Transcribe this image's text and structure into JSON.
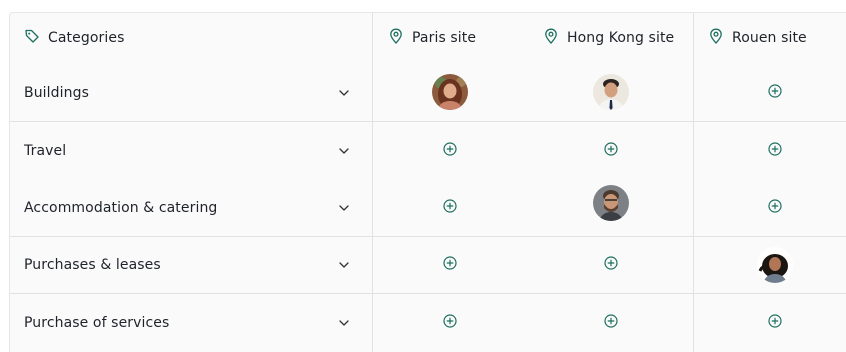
{
  "header": {
    "categories_label": "Categories",
    "categories_icon": "tag-icon",
    "site_icon": "map-pin-icon",
    "sites": [
      "Paris site",
      "Hong Kong site",
      "Rouen site"
    ]
  },
  "rows": [
    {
      "label": "Buildings",
      "cells": [
        "avatar-1",
        "avatar-2",
        "add"
      ]
    },
    {
      "label": "Travel",
      "cells": [
        "add",
        "add",
        "add"
      ]
    },
    {
      "label": "Accommodation & catering",
      "cells": [
        "add",
        "avatar-3",
        "add"
      ]
    },
    {
      "label": "Purchases & leases",
      "cells": [
        "add",
        "add",
        "avatar-4"
      ]
    },
    {
      "label": "Purchase of services",
      "cells": [
        "add",
        "add",
        "add"
      ]
    }
  ],
  "icons": {
    "row_toggle": "chevron-down-icon",
    "add_cell": "plus-circle-icon"
  },
  "colors": {
    "accent": "#1d6f5e",
    "border": "#e2e2e2",
    "panel": "#fafafa",
    "text": "#1f2329"
  }
}
